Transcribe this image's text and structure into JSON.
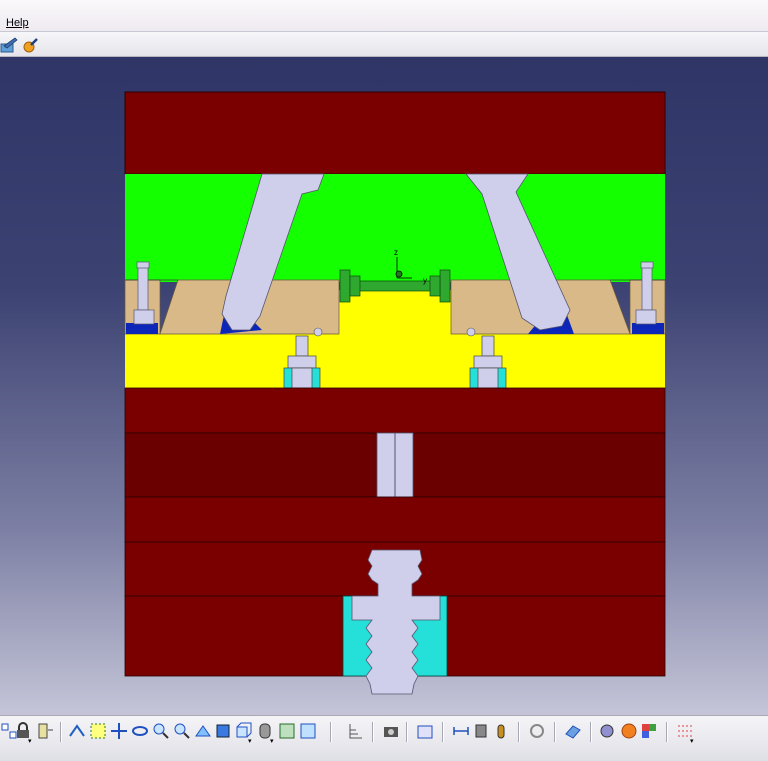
{
  "menubar": {
    "items": [
      "Help"
    ]
  },
  "top_toolbar": {
    "icons": [
      "paint-brush-icon",
      "color-fill-icon"
    ]
  },
  "viewport": {
    "background": [
      "#2f3566",
      "#c4c5d8"
    ],
    "compass_labels": {
      "z": "z",
      "y": "y"
    },
    "colors": {
      "plate": "#7a0000",
      "plate_dark": "#6a0000",
      "cavity": "#14ff00",
      "slider_insert": "#d8b987",
      "core": "#ffff00",
      "pin": "#cfcfeb",
      "wedge": "#0c27b8",
      "sprue_bushing": "#25e0d8",
      "guide": "#2fa82f"
    }
  },
  "bottom_toolbar": {
    "icons": [
      "multi-select-icon",
      "lock-icon",
      "parameters-icon",
      "fly-mode-icon",
      "fit-all-icon",
      "pan-icon",
      "rotate-icon",
      "zoom-in-icon",
      "zoom-out-icon",
      "normal-view-icon",
      "iso-view-icon",
      "cube-view-icon",
      "shading-icon",
      "hide-show-icon",
      "swap-space-icon",
      "tree-icon",
      "camera-icon",
      "snapshot-icon",
      "measure-between-icon",
      "measure-item-icon",
      "inertia-icon",
      "update-icon",
      "plane-icon",
      "apply-material-icon",
      "render-icon",
      "catalog-icon",
      "grid-icon"
    ]
  }
}
